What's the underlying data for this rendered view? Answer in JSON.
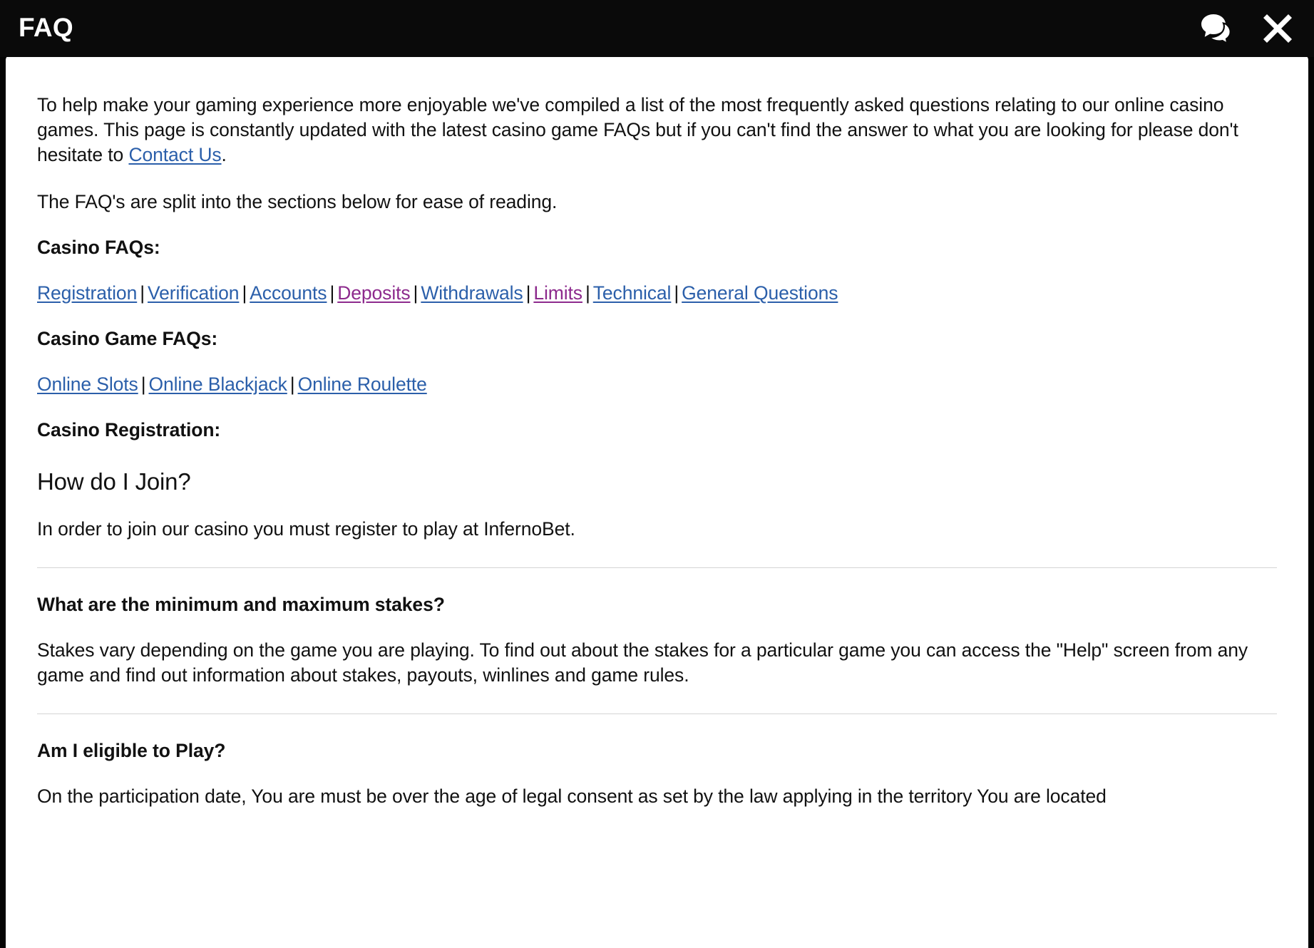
{
  "window": {
    "title": "FAQ",
    "background_color": "#0a0a0a",
    "panel_color": "#ffffff"
  },
  "header": {
    "title": "FAQ",
    "chat_icon": "chat-bubbles-icon",
    "close_icon": "close-x-icon"
  },
  "colors": {
    "link": "#2b5faa",
    "visited_link": "#8d2a8d",
    "text": "#111111",
    "divider": "#d4d4d4"
  },
  "intro": {
    "paragraph_1_before_link": "To help make your gaming experience more enjoyable we've compiled a list of the most frequently asked questions relating to our online casino games. This page is constantly updated with the latest casino game FAQs but if you can't find the answer to what you are looking for please don't hesitate to ",
    "contact_link": "Contact Us",
    "paragraph_1_after_link": ".",
    "paragraph_2": "The FAQ's are split into the sections below for ease of reading."
  },
  "casino_faqs": {
    "label": "Casino FAQs:",
    "links": [
      {
        "label": "Registration",
        "visited": false
      },
      {
        "label": "Verification",
        "visited": false
      },
      {
        "label": "Accounts",
        "visited": false
      },
      {
        "label": "Deposits",
        "visited": true
      },
      {
        "label": "Withdrawals",
        "visited": false
      },
      {
        "label": "Limits",
        "visited": true
      },
      {
        "label": "Technical",
        "visited": false
      },
      {
        "label": "General Questions",
        "visited": false
      }
    ],
    "separator": "|"
  },
  "casino_game_faqs": {
    "label": "Casino Game FAQs:",
    "links": [
      {
        "label": "Online Slots",
        "visited": false
      },
      {
        "label": "Online Blackjack",
        "visited": false
      },
      {
        "label": "Online Roulette",
        "visited": false
      }
    ],
    "separator": "|"
  },
  "casino_registration": {
    "label": "Casino Registration:",
    "entries": [
      {
        "question": "How do I Join?",
        "answer": "In order to join our casino you must register to play at InfernoBet."
      },
      {
        "question": "What are the minimum and maximum stakes?",
        "answer": "Stakes vary depending on the game you are playing. To find out about the stakes for a particular game you can access the \"Help\" screen from any game and find out information about stakes, payouts, winlines and game rules."
      },
      {
        "question": "Am I eligible to Play?",
        "answer": "On the participation date, You are must be over the age of legal consent as set by the law applying in the territory You are located"
      }
    ]
  }
}
